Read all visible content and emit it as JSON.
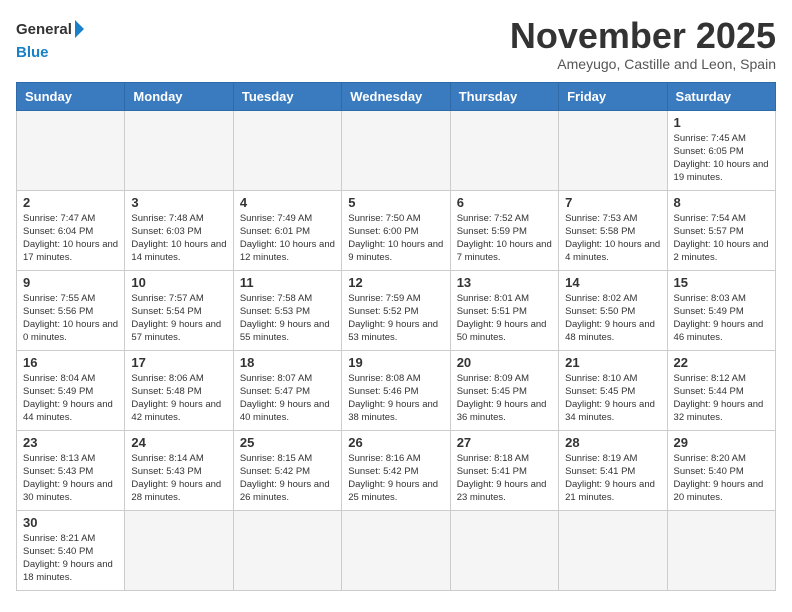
{
  "header": {
    "logo_general": "General",
    "logo_blue": "Blue",
    "month_title": "November 2025",
    "subtitle": "Ameyugo, Castille and Leon, Spain"
  },
  "days_of_week": [
    "Sunday",
    "Monday",
    "Tuesday",
    "Wednesday",
    "Thursday",
    "Friday",
    "Saturday"
  ],
  "weeks": [
    [
      {
        "day": "",
        "info": ""
      },
      {
        "day": "",
        "info": ""
      },
      {
        "day": "",
        "info": ""
      },
      {
        "day": "",
        "info": ""
      },
      {
        "day": "",
        "info": ""
      },
      {
        "day": "",
        "info": ""
      },
      {
        "day": "1",
        "info": "Sunrise: 7:45 AM\nSunset: 6:05 PM\nDaylight: 10 hours and 19 minutes."
      }
    ],
    [
      {
        "day": "2",
        "info": "Sunrise: 7:47 AM\nSunset: 6:04 PM\nDaylight: 10 hours and 17 minutes."
      },
      {
        "day": "3",
        "info": "Sunrise: 7:48 AM\nSunset: 6:03 PM\nDaylight: 10 hours and 14 minutes."
      },
      {
        "day": "4",
        "info": "Sunrise: 7:49 AM\nSunset: 6:01 PM\nDaylight: 10 hours and 12 minutes."
      },
      {
        "day": "5",
        "info": "Sunrise: 7:50 AM\nSunset: 6:00 PM\nDaylight: 10 hours and 9 minutes."
      },
      {
        "day": "6",
        "info": "Sunrise: 7:52 AM\nSunset: 5:59 PM\nDaylight: 10 hours and 7 minutes."
      },
      {
        "day": "7",
        "info": "Sunrise: 7:53 AM\nSunset: 5:58 PM\nDaylight: 10 hours and 4 minutes."
      },
      {
        "day": "8",
        "info": "Sunrise: 7:54 AM\nSunset: 5:57 PM\nDaylight: 10 hours and 2 minutes."
      }
    ],
    [
      {
        "day": "9",
        "info": "Sunrise: 7:55 AM\nSunset: 5:56 PM\nDaylight: 10 hours and 0 minutes."
      },
      {
        "day": "10",
        "info": "Sunrise: 7:57 AM\nSunset: 5:54 PM\nDaylight: 9 hours and 57 minutes."
      },
      {
        "day": "11",
        "info": "Sunrise: 7:58 AM\nSunset: 5:53 PM\nDaylight: 9 hours and 55 minutes."
      },
      {
        "day": "12",
        "info": "Sunrise: 7:59 AM\nSunset: 5:52 PM\nDaylight: 9 hours and 53 minutes."
      },
      {
        "day": "13",
        "info": "Sunrise: 8:01 AM\nSunset: 5:51 PM\nDaylight: 9 hours and 50 minutes."
      },
      {
        "day": "14",
        "info": "Sunrise: 8:02 AM\nSunset: 5:50 PM\nDaylight: 9 hours and 48 minutes."
      },
      {
        "day": "15",
        "info": "Sunrise: 8:03 AM\nSunset: 5:49 PM\nDaylight: 9 hours and 46 minutes."
      }
    ],
    [
      {
        "day": "16",
        "info": "Sunrise: 8:04 AM\nSunset: 5:49 PM\nDaylight: 9 hours and 44 minutes."
      },
      {
        "day": "17",
        "info": "Sunrise: 8:06 AM\nSunset: 5:48 PM\nDaylight: 9 hours and 42 minutes."
      },
      {
        "day": "18",
        "info": "Sunrise: 8:07 AM\nSunset: 5:47 PM\nDaylight: 9 hours and 40 minutes."
      },
      {
        "day": "19",
        "info": "Sunrise: 8:08 AM\nSunset: 5:46 PM\nDaylight: 9 hours and 38 minutes."
      },
      {
        "day": "20",
        "info": "Sunrise: 8:09 AM\nSunset: 5:45 PM\nDaylight: 9 hours and 36 minutes."
      },
      {
        "day": "21",
        "info": "Sunrise: 8:10 AM\nSunset: 5:45 PM\nDaylight: 9 hours and 34 minutes."
      },
      {
        "day": "22",
        "info": "Sunrise: 8:12 AM\nSunset: 5:44 PM\nDaylight: 9 hours and 32 minutes."
      }
    ],
    [
      {
        "day": "23",
        "info": "Sunrise: 8:13 AM\nSunset: 5:43 PM\nDaylight: 9 hours and 30 minutes."
      },
      {
        "day": "24",
        "info": "Sunrise: 8:14 AM\nSunset: 5:43 PM\nDaylight: 9 hours and 28 minutes."
      },
      {
        "day": "25",
        "info": "Sunrise: 8:15 AM\nSunset: 5:42 PM\nDaylight: 9 hours and 26 minutes."
      },
      {
        "day": "26",
        "info": "Sunrise: 8:16 AM\nSunset: 5:42 PM\nDaylight: 9 hours and 25 minutes."
      },
      {
        "day": "27",
        "info": "Sunrise: 8:18 AM\nSunset: 5:41 PM\nDaylight: 9 hours and 23 minutes."
      },
      {
        "day": "28",
        "info": "Sunrise: 8:19 AM\nSunset: 5:41 PM\nDaylight: 9 hours and 21 minutes."
      },
      {
        "day": "29",
        "info": "Sunrise: 8:20 AM\nSunset: 5:40 PM\nDaylight: 9 hours and 20 minutes."
      }
    ],
    [
      {
        "day": "30",
        "info": "Sunrise: 8:21 AM\nSunset: 5:40 PM\nDaylight: 9 hours and 18 minutes."
      },
      {
        "day": "",
        "info": ""
      },
      {
        "day": "",
        "info": ""
      },
      {
        "day": "",
        "info": ""
      },
      {
        "day": "",
        "info": ""
      },
      {
        "day": "",
        "info": ""
      },
      {
        "day": "",
        "info": ""
      }
    ]
  ]
}
